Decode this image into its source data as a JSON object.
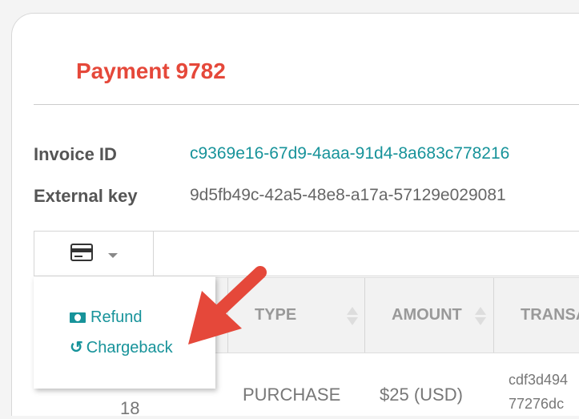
{
  "title": "Payment 9782",
  "fields": {
    "invoice_label": "Invoice ID",
    "invoice_value": "c9369e16-67d9-4aaa-91d4-8a683c778216",
    "external_label": "External key",
    "external_value": "9d5fb49c-42a5-48e8-a17a-57129e029081"
  },
  "toolbar": {
    "icon": "credit-card-icon"
  },
  "menu": {
    "items": [
      {
        "label": "Refund",
        "icon": "money-bill-icon"
      },
      {
        "label": "Chargeback",
        "icon": "undo-icon"
      }
    ]
  },
  "table": {
    "headers": [
      "TYPE",
      "AMOUNT",
      "TRANSA"
    ],
    "row": {
      "num": "18",
      "type": "PURCHASE",
      "amount": "$25 (USD)",
      "transaction_line1": "cdf3d494",
      "transaction_line2": "77276dc"
    }
  },
  "colors": {
    "title": "#e5483a",
    "link": "#17939a",
    "arrow": "#e5483a"
  }
}
